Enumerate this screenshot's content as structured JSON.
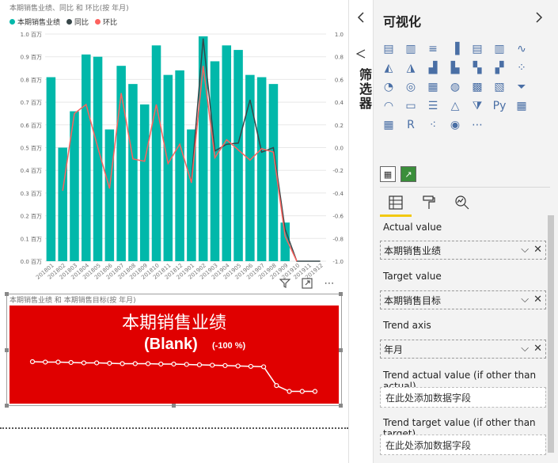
{
  "colors": {
    "bar": "#01b8aa",
    "yoy_line": "#374649",
    "mom_line": "#fd625e",
    "kpi_bg": "#e00000"
  },
  "chart_data": {
    "type": "bar",
    "title": "本期销售业绩、同比 和 环比(按 年月)",
    "categories": [
      "201801",
      "201802",
      "201803",
      "201804",
      "201805",
      "201806",
      "201807",
      "201808",
      "201809",
      "201810",
      "201811",
      "201812",
      "201901",
      "201902",
      "201903",
      "201904",
      "201905",
      "201906",
      "201907",
      "201908",
      "201909",
      "201910",
      "201911",
      "201912"
    ],
    "left_ticks": [
      "1.0 百万",
      "0.9 百万",
      "0.8 百万",
      "0.7 百万",
      "0.6 百万",
      "0.5 百万",
      "0.4 百万",
      "0.3 百万",
      "0.2 百万",
      "0.1 百万",
      "0.0 百万"
    ],
    "right_ticks": [
      "1.0",
      "0.8",
      "0.6",
      "0.4",
      "0.2",
      "0.0",
      "-0.2",
      "-0.4",
      "-0.6",
      "-0.8",
      "-1.0"
    ],
    "ylim": [
      0,
      1.0
    ],
    "y2lim": [
      -1.0,
      1.0
    ],
    "grid": true,
    "legend_position": "top-left",
    "series": [
      {
        "name": "本期销售业绩",
        "kind": "bar",
        "values": [
          0.81,
          0.5,
          0.66,
          0.91,
          0.9,
          0.58,
          0.86,
          0.78,
          0.69,
          0.95,
          0.82,
          0.84,
          0.58,
          0.99,
          0.88,
          0.95,
          0.93,
          0.82,
          0.81,
          0.78,
          0.17,
          0,
          0,
          0
        ]
      },
      {
        "name": "同比",
        "kind": "line",
        "values": [
          null,
          null,
          null,
          null,
          null,
          null,
          null,
          null,
          null,
          null,
          null,
          null,
          -0.28,
          0.96,
          -0.03,
          0.03,
          0.04,
          0.42,
          -0.04,
          0.0,
          -0.72,
          -1.0,
          -1.0,
          -1.0
        ]
      },
      {
        "name": "环比",
        "kind": "line",
        "values": [
          null,
          -0.38,
          0.3,
          0.38,
          0.0,
          -0.36,
          0.48,
          -0.1,
          -0.12,
          0.38,
          -0.14,
          0.03,
          -0.31,
          0.72,
          -0.09,
          0.07,
          -0.02,
          -0.11,
          -0.01,
          -0.04,
          -0.78,
          -1.0,
          null,
          null
        ]
      }
    ]
  },
  "kpi": {
    "subtitle": "本期销售业绩 和 本期销售目标(按 年月)",
    "title": "本期销售业绩",
    "value": "(Blank)",
    "delta": "(-100 %)",
    "trend_values": [
      0.81,
      0.8,
      0.8,
      0.79,
      0.78,
      0.78,
      0.77,
      0.76,
      0.76,
      0.76,
      0.75,
      0.75,
      0.74,
      0.73,
      0.72,
      0.71,
      0.7,
      0.69,
      0.68,
      0.2,
      0.05,
      0.05,
      0.05
    ]
  },
  "filter_pane": {
    "label": "筛选器"
  },
  "viz_pane": {
    "title": "可视化",
    "tabs": [
      "fields",
      "format",
      "analytics"
    ],
    "icons": [
      "stacked-bar-icon",
      "stacked-column-icon",
      "clustered-bar-icon",
      "clustered-column-icon",
      "100-bar-icon",
      "100-column-icon",
      "line-chart-icon",
      "area-chart-icon",
      "stacked-area-icon",
      "line-column-icon",
      "line-clustered-icon",
      "ribbon-icon",
      "waterfall-icon",
      "scatter-icon",
      "pie-icon",
      "donut-icon",
      "treemap-icon",
      "map-icon",
      "filled-map-icon",
      "shape-map-icon",
      "funnel-icon",
      "gauge-icon",
      "card-icon",
      "multirow-card-icon",
      "kpi-icon",
      "slicer-icon",
      "python-icon",
      "table-icon",
      "matrix-icon",
      "r-icon",
      "scatter-custom-icon",
      "globe-icon",
      "more-icon"
    ],
    "fields": [
      {
        "label": "Actual value",
        "value": "本期销售业绩"
      },
      {
        "label": "Target value",
        "value": "本期销售目标"
      },
      {
        "label": "Trend axis",
        "value": "年月"
      },
      {
        "label": "Trend actual value (if other than actual)",
        "placeholder": "在此处添加数据字段"
      },
      {
        "label": "Trend target value (if other than target)",
        "placeholder": "在此处添加数据字段"
      }
    ]
  }
}
